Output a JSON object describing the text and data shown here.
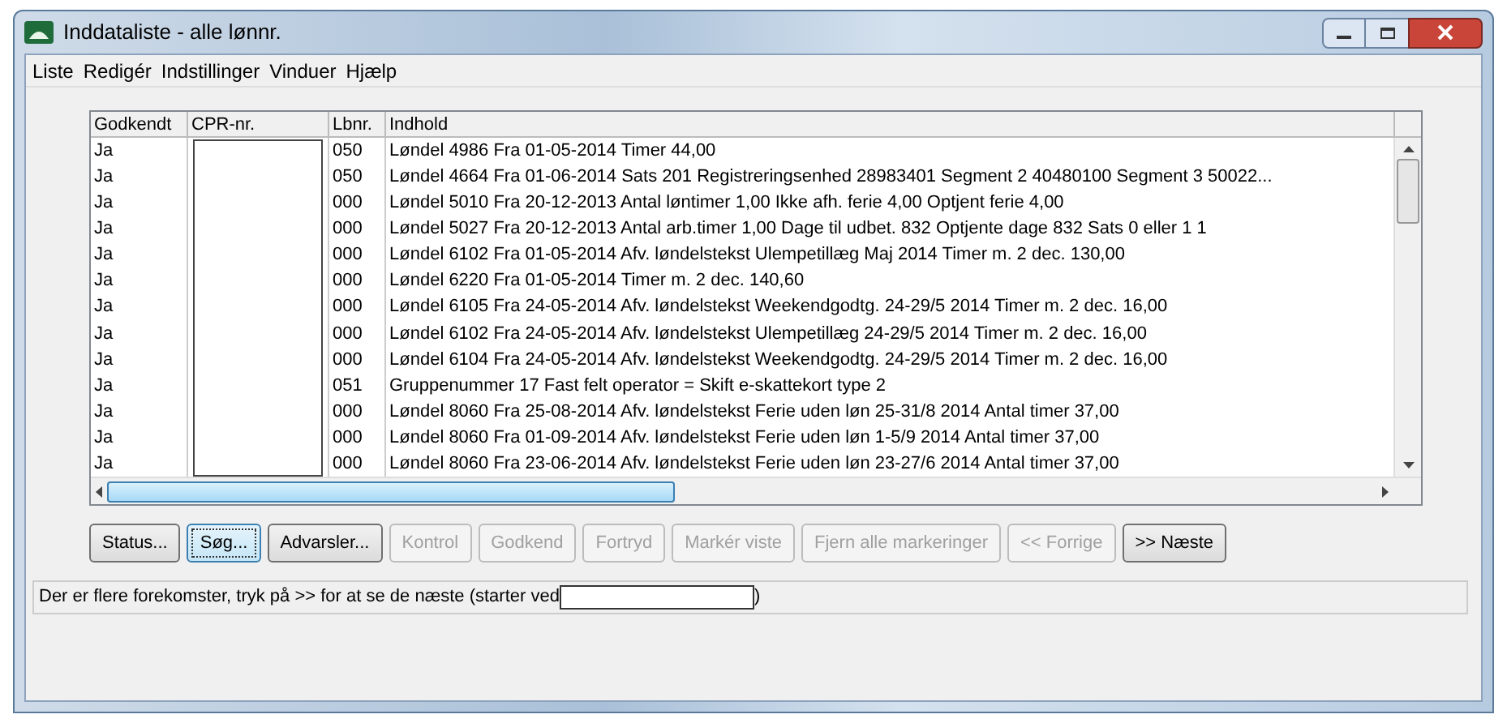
{
  "window": {
    "title": "Inddataliste - alle lønnr."
  },
  "menu": [
    "Liste",
    "Redigér",
    "Indstillinger",
    "Vinduer",
    "Hjælp"
  ],
  "table": {
    "columns": [
      "Godkendt",
      "CPR-nr.",
      "Lbnr.",
      "Indhold"
    ],
    "rows": [
      {
        "godkendt": "Ja",
        "lbnr": "050",
        "indhold": "Løndel 4986 Fra 01-05-2014 Timer 44,00"
      },
      {
        "godkendt": "Ja",
        "lbnr": "050",
        "indhold": "Løndel 4664 Fra 01-06-2014 Sats 201 Registreringsenhed 28983401 Segment 2   40480100 Segment 3 50022..."
      },
      {
        "godkendt": "Ja",
        "lbnr": "000",
        "indhold": "Løndel 5010 Fra 20-12-2013 Antal løntimer 1,00 Ikke afh. ferie 4,00 Optjent ferie 4,00"
      },
      {
        "godkendt": "Ja",
        "lbnr": "000",
        "indhold": "Løndel 5027 Fra 20-12-2013 Antal arb.timer 1,00 Dage til udbet. 832 Optjente dage 832 Sats 0 eller 1 1"
      },
      {
        "godkendt": "Ja",
        "lbnr": "000",
        "indhold": "Løndel 6102 Fra 01-05-2014 Afv. løndelstekst Ulempetillæg Maj 2014 Timer m. 2 dec. 130,00"
      },
      {
        "godkendt": "Ja",
        "lbnr": "000",
        "indhold": "Løndel 6220 Fra 01-05-2014 Timer m. 2 dec. 140,60"
      },
      {
        "godkendt": "Ja",
        "lbnr": "000",
        "indhold": "Løndel 6105 Fra 24-05-2014 Afv. løndelstekst Weekendgodtg. 24-29/5 2014 Timer m. 2 dec. 16,00"
      },
      {
        "godkendt": "Ja",
        "lbnr": "000",
        "indhold": "Løndel 6102 Fra 24-05-2014 Afv. løndelstekst Ulempetillæg 24-29/5 2014 Timer m. 2 dec. 16,00"
      },
      {
        "godkendt": "Ja",
        "lbnr": "000",
        "indhold": "Løndel 6104 Fra 24-05-2014 Afv. løndelstekst Weekendgodtg. 24-29/5 2014 Timer m. 2 dec. 16,00"
      },
      {
        "godkendt": "Ja",
        "lbnr": "051",
        "indhold": "Gruppenummer 17 Fast felt operator = Skift e-skattekort type 2"
      },
      {
        "godkendt": "Ja",
        "lbnr": "000",
        "indhold": "Løndel 8060 Fra 25-08-2014 Afv. løndelstekst Ferie uden løn 25-31/8 2014 Antal timer 37,00"
      },
      {
        "godkendt": "Ja",
        "lbnr": "000",
        "indhold": "Løndel 8060 Fra 01-09-2014 Afv. løndelstekst Ferie uden løn 1-5/9 2014 Antal timer 37,00"
      },
      {
        "godkendt": "Ja",
        "lbnr": "000",
        "indhold": "Løndel 8060 Fra 23-06-2014 Afv. løndelstekst Ferie uden løn 23-27/6 2014 Antal timer 37,00"
      }
    ]
  },
  "buttons": [
    {
      "label": "Status...",
      "disabled": false,
      "focused": false
    },
    {
      "label": "Søg...",
      "disabled": false,
      "focused": true
    },
    {
      "label": "Advarsler...",
      "disabled": false,
      "focused": false
    },
    {
      "label": "Kontrol",
      "disabled": true,
      "focused": false
    },
    {
      "label": "Godkend",
      "disabled": true,
      "focused": false
    },
    {
      "label": "Fortryd",
      "disabled": true,
      "focused": false
    },
    {
      "label": "Markér viste",
      "disabled": true,
      "focused": false
    },
    {
      "label": "Fjern alle markeringer",
      "disabled": true,
      "focused": false
    },
    {
      "label": "<< Forrige",
      "disabled": true,
      "focused": false
    },
    {
      "label": ">> Næste",
      "disabled": false,
      "focused": false
    }
  ],
  "status_bar": {
    "text": "Der er flere forekomster, tryk på >> for at se de næste (starter ved",
    "suffix": ")"
  }
}
